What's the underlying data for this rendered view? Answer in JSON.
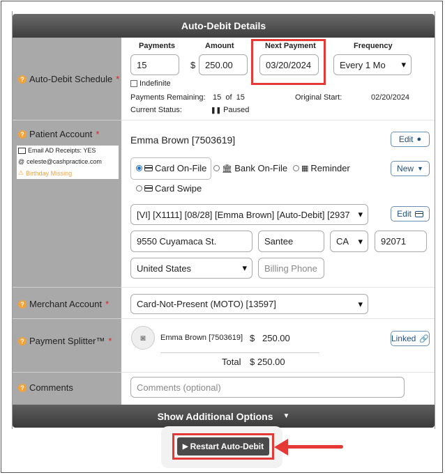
{
  "header": {
    "title": "Auto-Debit Details"
  },
  "schedule": {
    "label": "Auto-Debit Schedule",
    "col_payments": "Payments",
    "col_amount": "Amount",
    "col_next": "Next Payment",
    "col_frequency": "Frequency",
    "payments_value": "15",
    "currency": "$",
    "amount_value": "250.00",
    "next_value": "03/20/2024",
    "frequency_value": "Every 1 Mo",
    "indefinite_label": "Indefinite",
    "remaining_label": "Payments Remaining:",
    "remaining_value": "15  of  15",
    "original_start_label": "Original Start:",
    "original_start_value": "02/20/2024",
    "status_label": "Current Status:",
    "status_value": "Paused"
  },
  "patient": {
    "label": "Patient Account",
    "email_receipts": "Email AD Receipts: YES",
    "email": "celeste@cashpractice.com",
    "birthday": "Birthday Missing",
    "name": "Emma Brown [7503619]",
    "edit_label": "Edit",
    "new_label": "New",
    "opt_card_on_file": "Card On-File",
    "opt_bank_on_file": "Bank On-File",
    "opt_reminder": "Reminder",
    "opt_card_swipe": "Card Swipe",
    "card_value": "[VI] [X1111] [08/28] [Emma Brown] [Auto-Debit] [2937",
    "card_edit_label": "Edit",
    "address": "9550 Cuyamaca St.",
    "city": "Santee",
    "state": "CA",
    "zip": "92071",
    "country": "United States",
    "phone_placeholder": "Billing Phone"
  },
  "merchant": {
    "label": "Merchant Account",
    "value": "Card-Not-Present (MOTO) [13597]"
  },
  "splitter": {
    "label": "Payment Splitter™",
    "patient": "Emma Brown [7503619]",
    "currency": "$",
    "amount": "250.00",
    "linked_label": "Linked",
    "total_label": "Total",
    "total_value": "$ 250.00"
  },
  "comments": {
    "label": "Comments",
    "placeholder": "Comments (optional)"
  },
  "footer": {
    "show_options": "Show Additional Options",
    "restart_button": "Restart Auto-Debit"
  },
  "colors": {
    "highlight": "#e53935",
    "accent": "#f0a23c",
    "link": "#1f4f7f"
  }
}
